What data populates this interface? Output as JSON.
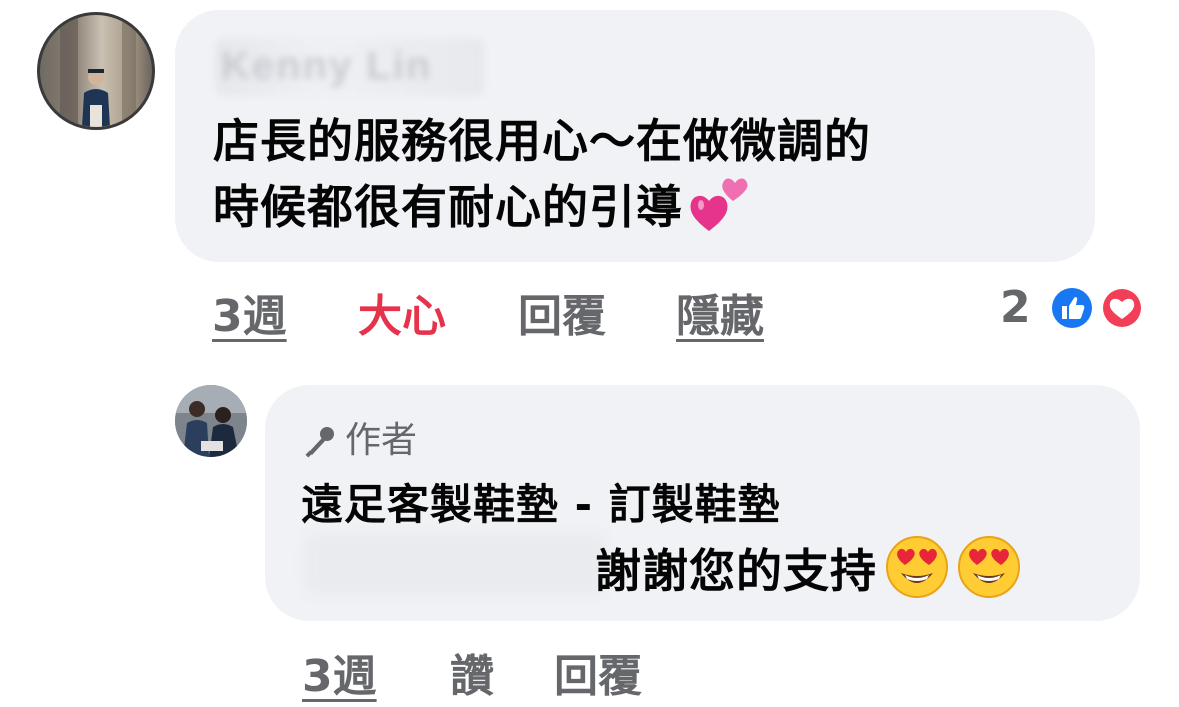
{
  "comment": {
    "author_name_blurred": "Kenny Lin",
    "text_line1": "店長的服務很用心～在做微調的",
    "text_line2": "時候都很有耐心的引導",
    "text_emoji": "two-hearts-emoji",
    "actions": {
      "time": "3週",
      "reaction": "大心",
      "reply": "回覆",
      "hide": "隱藏"
    },
    "reaction_count": "2",
    "reaction_icons": [
      "like-reaction-icon",
      "love-reaction-icon"
    ],
    "colors": {
      "love": "#e5334b",
      "like": "#1877f2",
      "action_gray": "#65676b",
      "bubble": "#f0f2f5"
    }
  },
  "reply": {
    "badge_icon": "microphone-icon",
    "badge_label": "作者",
    "author_name": "遠足客製鞋墊 - 訂製鞋墊",
    "text": "謝謝您的支持",
    "text_emoji": [
      "heart-eyes-emoji",
      "heart-eyes-emoji"
    ],
    "actions": {
      "time": "3週",
      "like": "讚",
      "reply": "回覆"
    }
  }
}
